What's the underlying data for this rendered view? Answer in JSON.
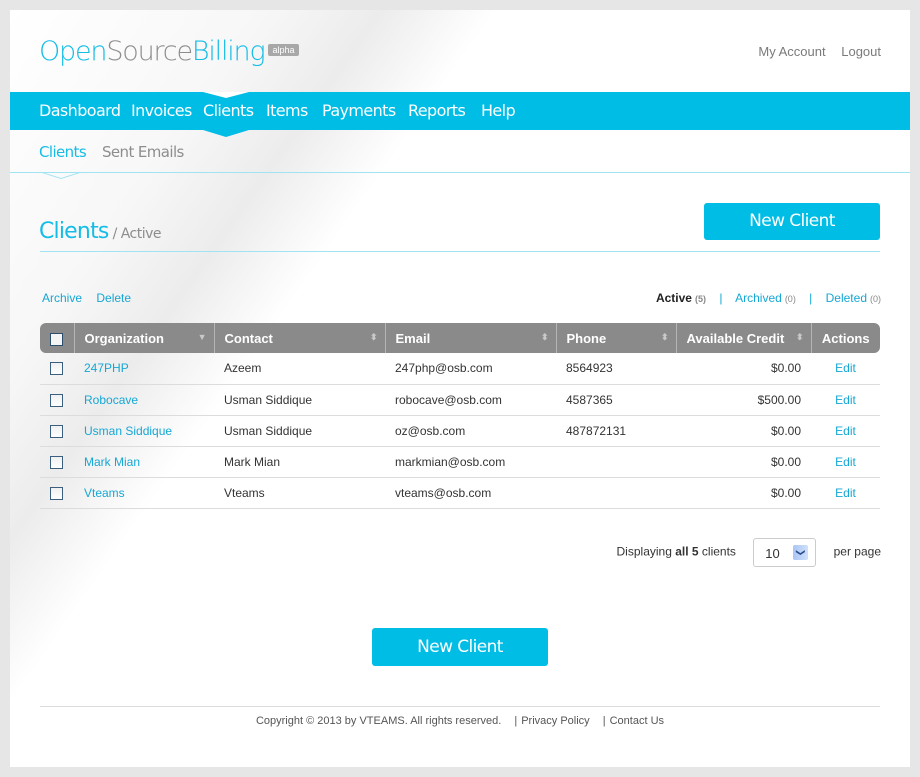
{
  "app": {
    "logo_part1": "Open",
    "logo_part2": "Source",
    "logo_part3": "Billing",
    "logo_badge": "alpha"
  },
  "colors": {
    "brand": "#00bde6",
    "link": "#15a7d4",
    "header": "#8a8a8a"
  },
  "top_links": [
    "My Account",
    "Logout"
  ],
  "main_nav": {
    "items": [
      "Dashboard",
      "Invoices",
      "Clients",
      "Items",
      "Payments",
      "Reports",
      "Help"
    ],
    "active": "Clients"
  },
  "sub_nav": {
    "items": [
      "Clients",
      "Sent Emails"
    ],
    "active": "Clients"
  },
  "page": {
    "title": "Clients",
    "subtitle": "/ Active",
    "new_button": "New Client"
  },
  "bulk_actions": [
    "Archive",
    "Delete"
  ],
  "filters": {
    "active_label": "Active",
    "active_count": "(5)",
    "archived_label": "Archived",
    "archived_count": "(0)",
    "deleted_label": "Deleted",
    "deleted_count": "(0)",
    "separator": "|"
  },
  "table": {
    "columns": [
      "Organization",
      "Contact",
      "Email",
      "Phone",
      "Available Credit",
      "Actions"
    ],
    "rows": [
      {
        "organization": "247PHP",
        "contact": "Azeem",
        "email": "247php@osb.com",
        "phone": "8564923",
        "credit": "$0.00",
        "action": "Edit"
      },
      {
        "organization": "Robocave",
        "contact": "Usman Siddique",
        "email": "robocave@osb.com",
        "phone": "4587365",
        "credit": "$500.00",
        "action": "Edit"
      },
      {
        "organization": "Usman Siddique",
        "contact": "Usman Siddique",
        "email": "oz@osb.com",
        "phone": "487872131",
        "credit": "$0.00",
        "action": "Edit"
      },
      {
        "organization": "Mark Mian",
        "contact": "Mark Mian",
        "email": "markmian@osb.com",
        "phone": "",
        "credit": "$0.00",
        "action": "Edit"
      },
      {
        "organization": "Vteams",
        "contact": "Vteams",
        "email": "vteams@osb.com",
        "phone": "",
        "credit": "$0.00",
        "action": "Edit"
      }
    ]
  },
  "pager": {
    "prefix": "Displaying ",
    "bold": "all 5",
    "suffix": " clients",
    "per_page_value": "10",
    "per_page_label": "per page"
  },
  "footer": {
    "copyright": "Copyright © 2013 by VTEAMS. All rights reserved.",
    "links": [
      "Privacy Policy",
      "Contact Us"
    ],
    "separator": "|"
  }
}
